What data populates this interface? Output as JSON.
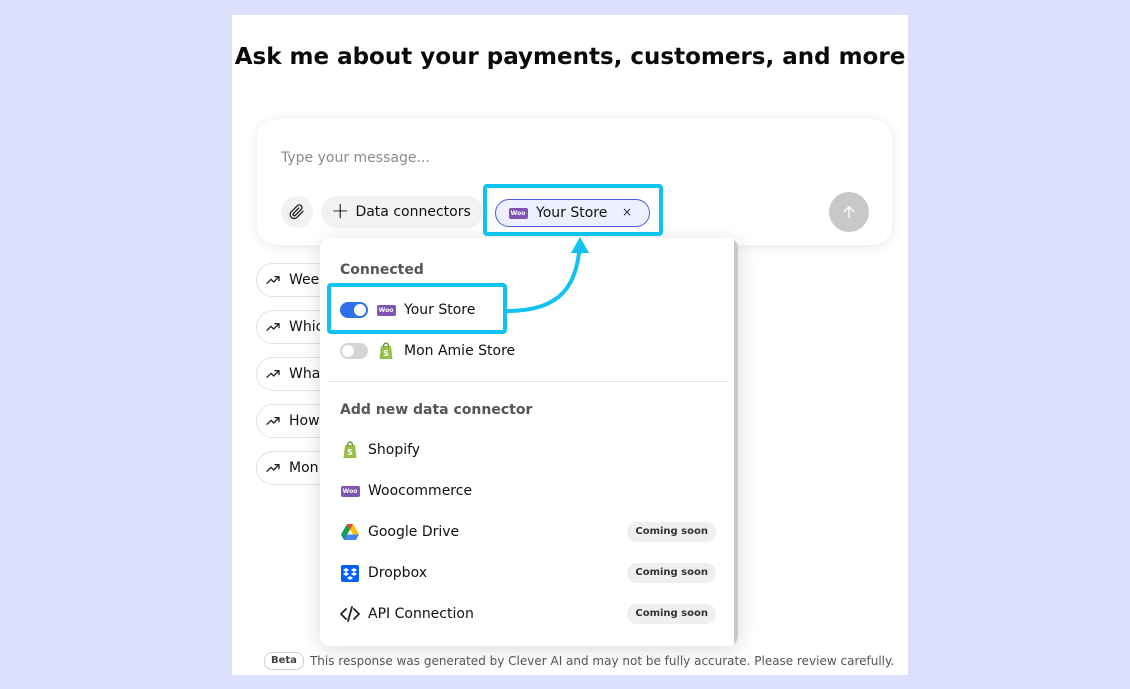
{
  "heading": "Ask me about your payments, customers, and more",
  "composer": {
    "placeholder": "Type your message...",
    "data_connectors_label": "Data connectors",
    "selected_chip": "Your Store",
    "chip_remove": "×"
  },
  "suggestions": [
    "Wee",
    "Whic",
    "Wha",
    "How",
    "Mon"
  ],
  "dropdown": {
    "connected_heading": "Connected",
    "connected": [
      {
        "label": "Your Store",
        "logo": "woocommerce-icon",
        "enabled": true
      },
      {
        "label": "Mon Amie Store",
        "logo": "shopify-icon",
        "enabled": false
      }
    ],
    "add_heading": "Add new data connector",
    "add_items": [
      {
        "label": "Shopify",
        "logo": "shopify-icon",
        "badge": ""
      },
      {
        "label": "Woocommerce",
        "logo": "woocommerce-icon",
        "badge": ""
      },
      {
        "label": "Google Drive",
        "logo": "google-drive-icon",
        "badge": "Coming soon"
      },
      {
        "label": "Dropbox",
        "logo": "dropbox-icon",
        "badge": "Coming soon"
      },
      {
        "label": "API Connection",
        "logo": "code-icon",
        "badge": "Coming soon"
      }
    ]
  },
  "footer": {
    "badge": "Beta",
    "disclaimer": "This response was generated by Clever AI and may not be fully accurate. Please review carefully."
  },
  "colors": {
    "highlight": "#10c2ef",
    "toggle_on": "#2f6fe8",
    "woo_purple": "#7f54b3",
    "shopify_green": "#95bf47",
    "background": "#dde0fc"
  }
}
